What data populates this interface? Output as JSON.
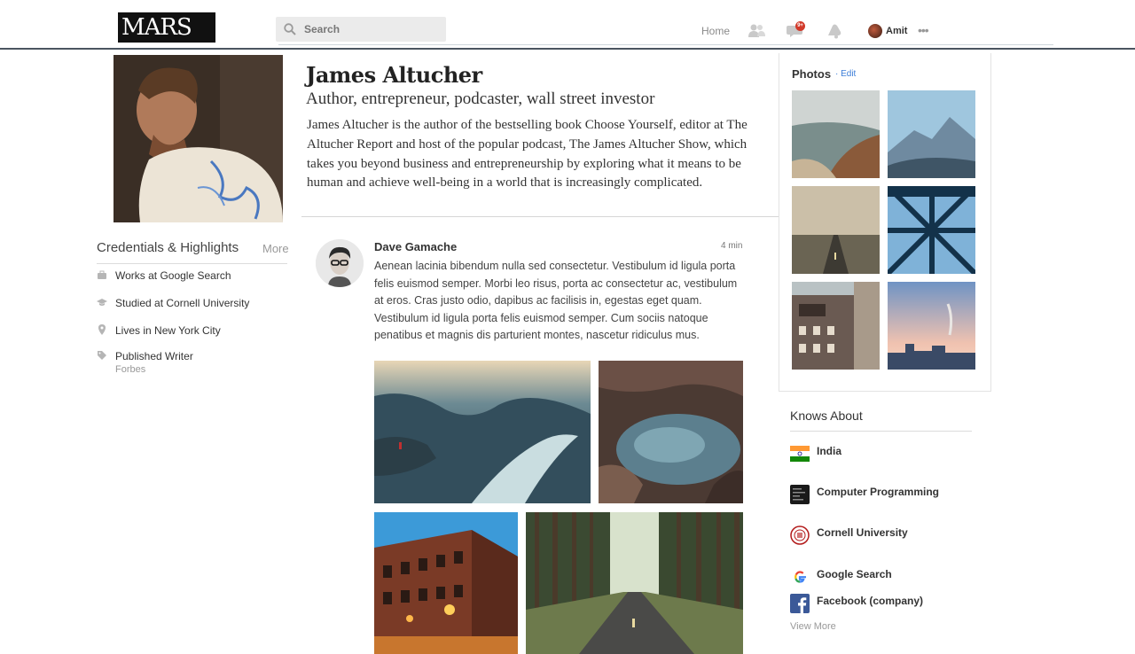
{
  "header": {
    "logo_text": "MARS",
    "search_placeholder": "Search",
    "nav_home": "Home",
    "notification_badge": "9+",
    "user_name": "Amit",
    "more_label": "•••"
  },
  "profile": {
    "name": "James Altucher",
    "tagline": "Author, entrepreneur, podcaster, wall street investor",
    "bio": "James Altucher is the author of the bestselling book Choose Yourself, editor at The Altucher Report and host of the popular podcast, The James Altucher Show, which takes you beyond business and entrepreneurship by exploring what it means to be human and achieve well-being in a world that is increasingly complicated."
  },
  "credentials": {
    "title": "Credentials & Highlights",
    "more_label": "More",
    "items": [
      {
        "label": "Works at Google Search",
        "icon": "briefcase-icon"
      },
      {
        "label": "Studied at Cornell University",
        "icon": "graduation-cap-icon"
      },
      {
        "label": "Lives in New York City",
        "icon": "location-pin-icon"
      },
      {
        "label": "Published Writer",
        "icon": "tag-icon",
        "sub": "Forbes"
      }
    ]
  },
  "post": {
    "author": "Dave Gamache",
    "time": "4 min",
    "text": "Aenean lacinia bibendum nulla sed consectetur. Vestibulum id ligula porta felis euismod semper. Morbi leo risus, porta ac consectetur ac, vestibulum at eros. Cras justo odio, dapibus ac facilisis in, egestas eget quam. Vestibulum id ligula porta felis euismod semper. Cum sociis natoque penatibus et magnis dis parturient montes, nascetur ridiculus mus."
  },
  "photos": {
    "title": "Photos",
    "edit_label": "· Edit"
  },
  "knows_about": {
    "title": "Knows About",
    "topics": [
      {
        "label": "India",
        "icon": "india-flag-icon"
      },
      {
        "label": "Computer Programming",
        "icon": "code-terminal-icon"
      },
      {
        "label": "Cornell University",
        "icon": "cornell-seal-icon"
      },
      {
        "label": "Google Search",
        "icon": "google-g-icon"
      },
      {
        "label": "Facebook (company)",
        "icon": "facebook-f-icon"
      }
    ],
    "view_more": "View More"
  },
  "colors": {
    "link_blue": "#3b7dd8",
    "badge_red": "#d23a2a",
    "facebook_blue": "#3b5998"
  }
}
